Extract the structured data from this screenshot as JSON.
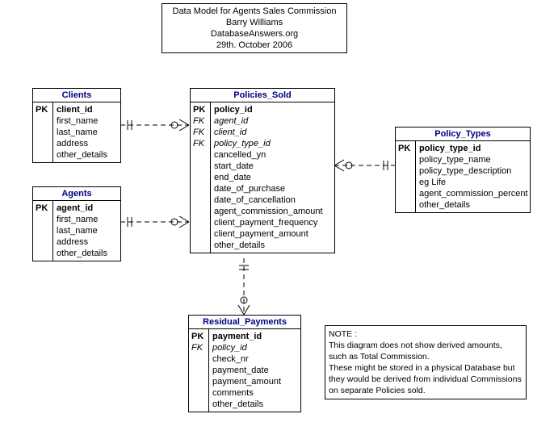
{
  "title": {
    "line1": "Data Model for Agents Sales Commission",
    "line2": "Barry Williams",
    "line3": "DatabaseAnswers.org",
    "line4": "29th. October 2006"
  },
  "entities": {
    "clients": {
      "name": "Clients",
      "pk": "client_id",
      "cols": [
        "first_name",
        "last_name",
        "address",
        "other_details"
      ]
    },
    "agents": {
      "name": "Agents",
      "pk": "agent_id",
      "cols": [
        "first_name",
        "last_name",
        "address",
        "other_details"
      ]
    },
    "policies_sold": {
      "name": "Policies_Sold",
      "pk": "policy_id",
      "fks": [
        "agent_id",
        "client_id",
        "policy_type_id"
      ],
      "cols": [
        "cancelled_yn",
        "start_date",
        "end_date",
        "date_of_purchase",
        "date_of_cancellation",
        "agent_commission_amount",
        "client_payment_frequency",
        "client_payment_amount",
        "other_details"
      ]
    },
    "policy_types": {
      "name": "Policy_Types",
      "pk": "policy_type_id",
      "cols": [
        "policy_type_name",
        "policy_type_description",
        "eg Life",
        "agent_commission_percent",
        "other_details"
      ]
    },
    "residual_payments": {
      "name": "Residual_Payments",
      "pk": "payment_id",
      "fk": "policy_id",
      "cols": [
        "check_nr",
        "payment_date",
        "payment_amount",
        "comments",
        "other_details"
      ]
    }
  },
  "note": {
    "line1": "NOTE :",
    "line2": "This diagram does not show derived amounts,",
    "line3": "such as Total Commission.",
    "line4": "These might be stored in a physical Database but",
    "line5": "they would be derived from individual Commissions",
    "line6": "on separate Policies sold."
  }
}
